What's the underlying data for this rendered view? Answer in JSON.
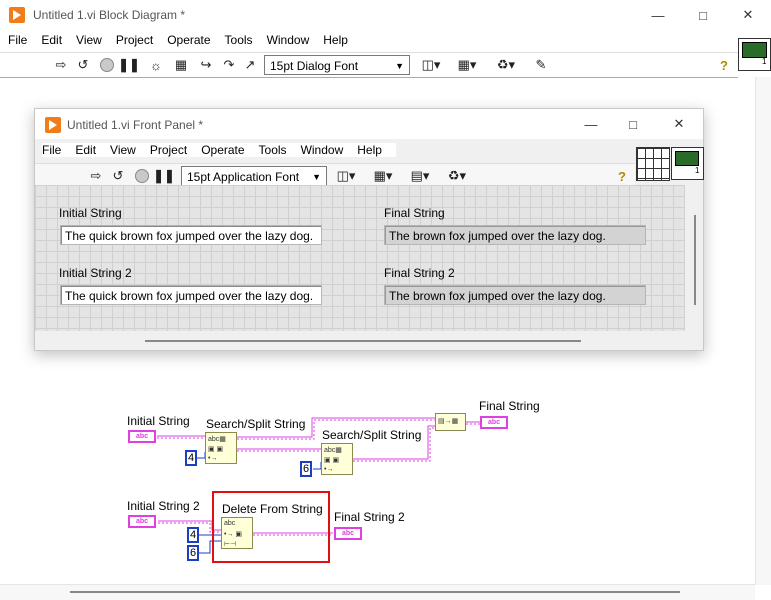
{
  "block_diagram": {
    "title": "Untitled 1.vi Block Diagram *",
    "menu": [
      "File",
      "Edit",
      "View",
      "Project",
      "Operate",
      "Tools",
      "Window",
      "Help"
    ],
    "font_select": "15pt Dialog Font"
  },
  "front_panel": {
    "title": "Untitled 1.vi Front Panel *",
    "menu": [
      "File",
      "Edit",
      "View",
      "Project",
      "Operate",
      "Tools",
      "Window",
      "Help"
    ],
    "font_select": "15pt Application Font",
    "controls": [
      {
        "label": "Initial String",
        "value": "The quick brown fox jumped over the lazy dog."
      },
      {
        "label": "Initial String 2",
        "value": "The quick brown fox jumped over the lazy dog."
      }
    ],
    "indicators": [
      {
        "label": "Final String",
        "value": "The brown fox jumped over the lazy dog."
      },
      {
        "label": "Final String 2",
        "value": "The brown fox jumped over the lazy dog."
      }
    ]
  },
  "diagram": {
    "labels": {
      "initial_string": "Initial String",
      "search_split_1": "Search/Split String",
      "search_split_2": "Search/Split String",
      "final_string": "Final String",
      "initial_string_2": "Initial String 2",
      "delete_from_string": "Delete From String",
      "final_string_2": "Final String 2"
    },
    "constants": {
      "c1": "4",
      "c2": "6",
      "c3": "4",
      "c4": "6"
    },
    "terminal_text": "abc"
  },
  "colors": {
    "string_wire": "#e040e0",
    "numeric_wire": "#1a3fc4",
    "highlight": "#e01010",
    "node_fill": "#ffffd8"
  }
}
